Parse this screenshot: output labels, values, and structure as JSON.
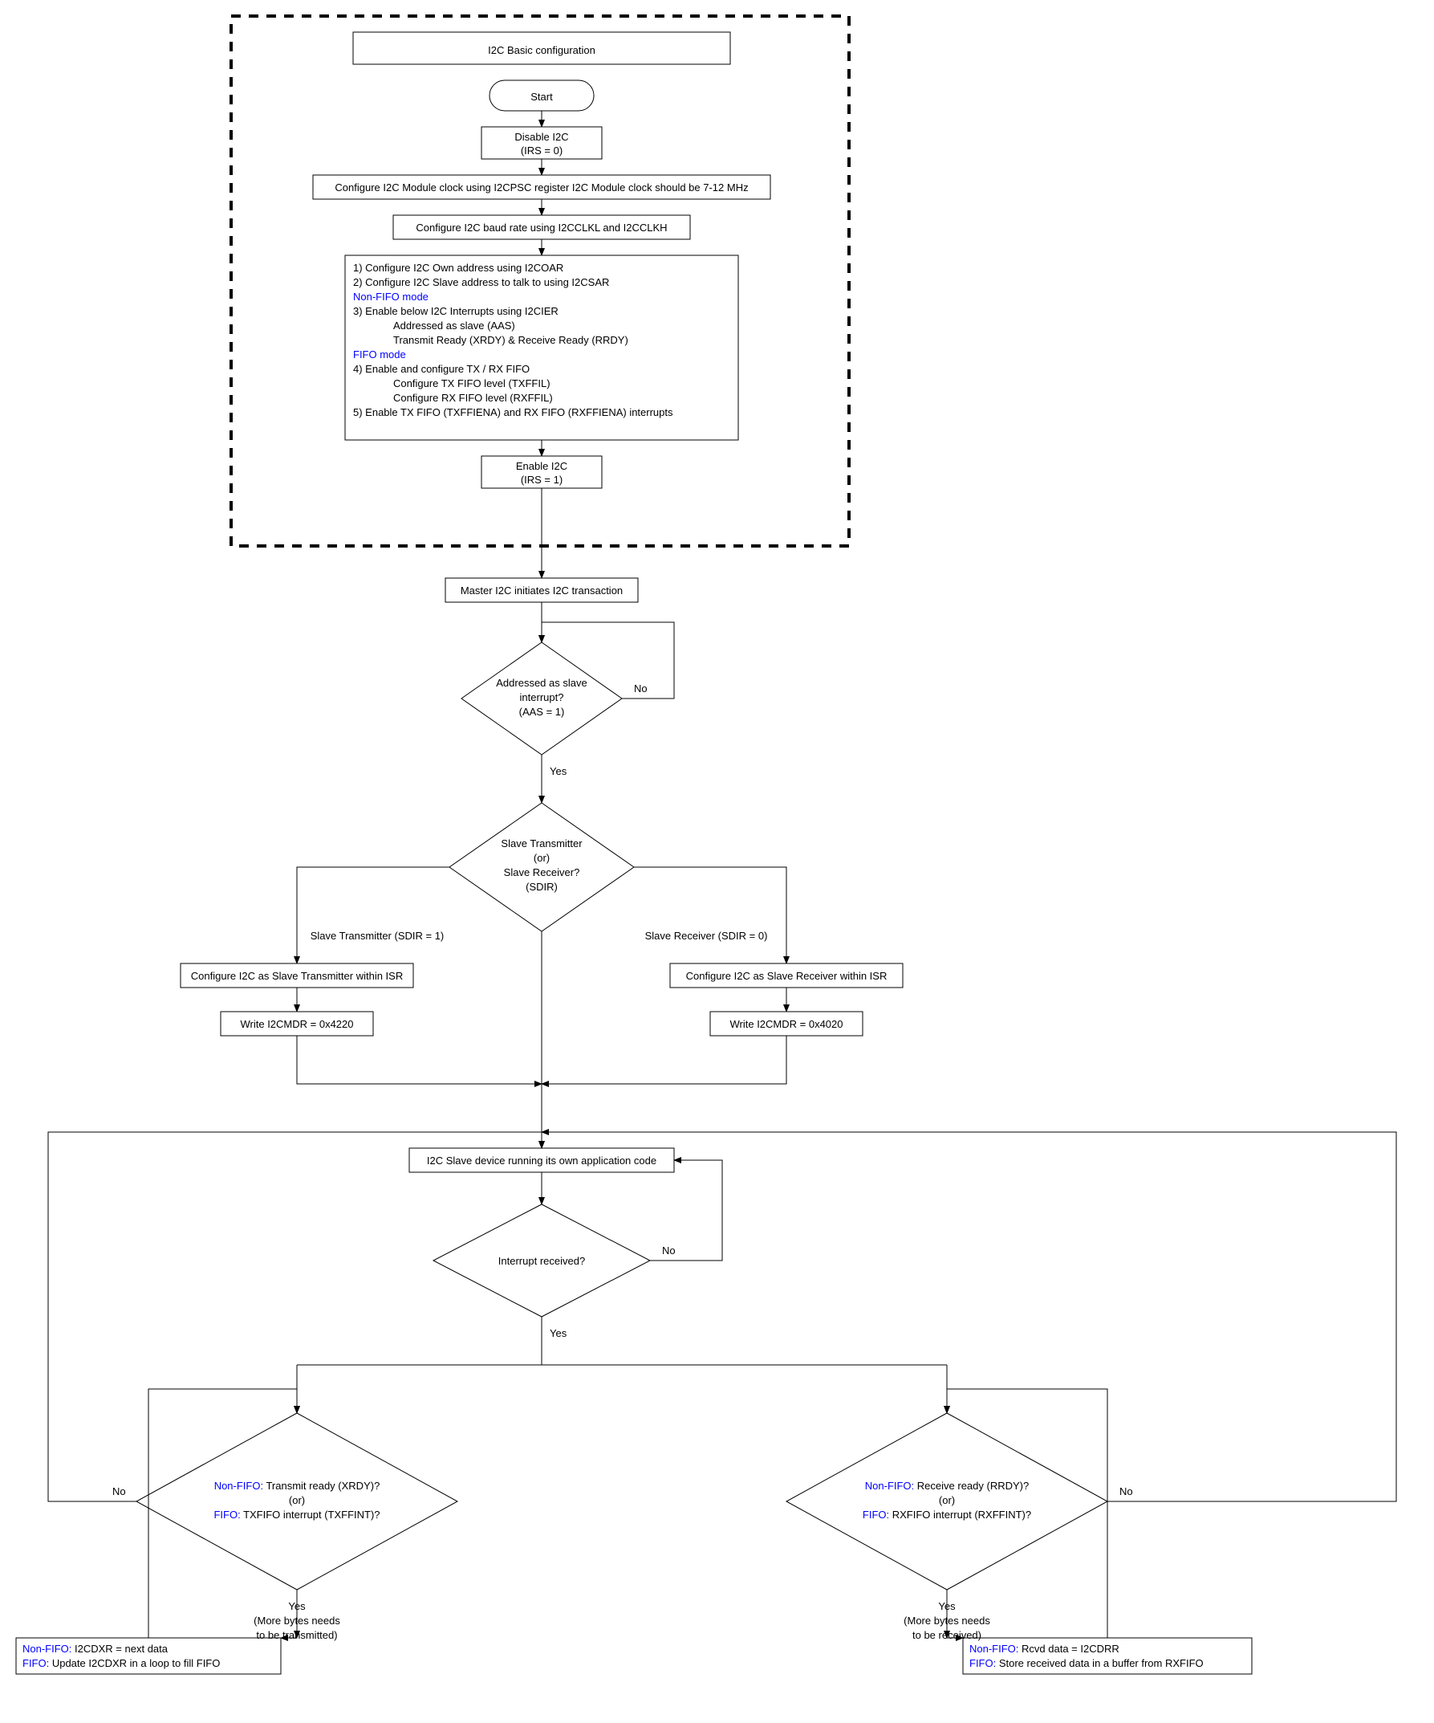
{
  "title": "I2C Basic configuration",
  "start": "Start",
  "disable1": "Disable I2C",
  "disable2": "(IRS = 0)",
  "cfgClock": "Configure I2C Module clock using I2CPSC register I2C Module clock should be 7-12 MHz",
  "cfgBaud": "Configure I2C baud rate using I2CCLKL and I2CCLKH",
  "cfg1": "1) Configure I2C Own address using I2COAR",
  "cfg2": "2) Configure I2C Slave address to talk to using I2CSAR",
  "nonFifoMode": "Non-FIFO mode",
  "cfg3": "3) Enable below I2C Interrupts using I2CIER",
  "cfg3a": "Addressed as slave (AAS)",
  "cfg3b": "Transmit Ready (XRDY) & Receive Ready (RRDY)",
  "fifoMode": "FIFO mode",
  "cfg4": "4) Enable and configure TX / RX FIFO",
  "cfg4a": "Configure TX FIFO level (TXFFIL)",
  "cfg4b": "Configure RX FIFO level (RXFFIL)",
  "cfg5": "5) Enable TX FIFO (TXFFIENA) and RX FIFO (RXFFIENA) interrupts",
  "enable1": "Enable I2C",
  "enable2": "(IRS = 1)",
  "masterInit": "Master I2C initiates I2C transaction",
  "aas1": "Addressed as slave",
  "aas2": "interrupt?",
  "aas3": "(AAS = 1)",
  "no": "No",
  "yes": "Yes",
  "sdir1": "Slave Transmitter",
  "sdir2": "(or)",
  "sdir3": "Slave Receiver?",
  "sdir4": "(SDIR)",
  "txLabel": "Slave Transmitter (SDIR = 1)",
  "rxLabel": "Slave Receiver (SDIR = 0)",
  "cfgTx": "Configure I2C as Slave Transmitter within ISR",
  "cfgRx": "Configure I2C as Slave Receiver within ISR",
  "writeTx": "Write I2CMDR = 0x4220",
  "writeRx": "Write I2CMDR = 0x4020",
  "appCode": "I2C Slave device running its own application code",
  "intRecv": "Interrupt received?",
  "txD1a": "Non-FIFO:",
  "txD1b": " Transmit ready (XRDY)?",
  "txD2": "(or)",
  "txD3a": "FIFO:",
  "txD3b": " TXFIFO interrupt (TXFFINT)?",
  "rxD1a": "Non-FIFO:",
  "rxD1b": " Receive ready (RRDY)?",
  "rxD2": "(or)",
  "rxD3a": "FIFO:",
  "rxD3b": " RXFIFO interrupt (RXFFINT)?",
  "txAct1a": "Non-FIFO:",
  "txAct1b": " I2CDXR = next data",
  "txAct2a": "FIFO:",
  "txAct2b": " Update I2CDXR in a loop to fill FIFO",
  "rxAct1a": "Non-FIFO:",
  "rxAct1b": " Rcvd data = I2CDRR",
  "rxAct2a": "FIFO:",
  "rxAct2b": " Store received data in a buffer from RXFIFO",
  "moreTx1": "(More bytes needs",
  "moreTx2": "to be transmitted)",
  "moreRx1": "(More bytes needs",
  "moreRx2": "to be received)"
}
